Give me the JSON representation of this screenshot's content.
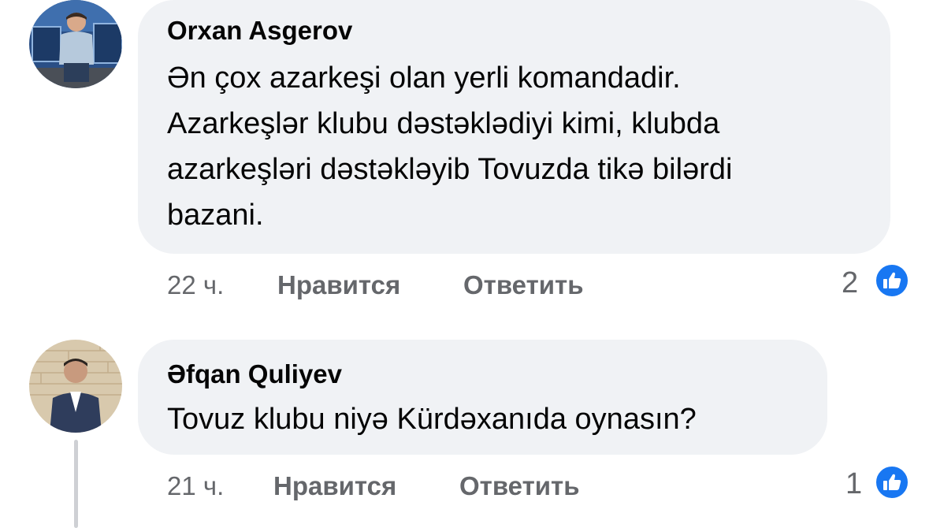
{
  "comments": [
    {
      "author": "Orxan Asgerov",
      "text": "Ən çox azarkeşi olan yerli komandadir. Azarkeşlər klubu dəstəklədiyi kimi, klubda azarkeşləri dəstəkləyib Tovuzda tikə bilərdi bazani.",
      "lines": [
        "Ən çox azarkeşi olan yerli komandadir.",
        "Azarkeşlər klubu dəstəklədiyi kimi, klubda",
        "azarkeşləri dəstəkləyib Tovuzda tikə bilərdi",
        "bazani."
      ],
      "time": "22 ч.",
      "like_label": "Нравится",
      "reply_label": "Ответить",
      "reaction_count": "2",
      "reaction_icon": "like-icon"
    },
    {
      "author": "Əfqan Quliyev",
      "text": "Tovuz klubu niyə Kürdəxanıda oynasın?",
      "lines": [
        "Tovuz klubu niyə Kürdəxanıda oynasın?"
      ],
      "time": "21 ч.",
      "like_label": "Нравится",
      "reply_label": "Ответить",
      "reaction_count": "1",
      "reaction_icon": "like-icon"
    }
  ],
  "colors": {
    "bubble": "#f0f2f5",
    "meta_text": "#65676b",
    "like_blue": "#1877f2",
    "thread_line": "#ced0d4"
  }
}
